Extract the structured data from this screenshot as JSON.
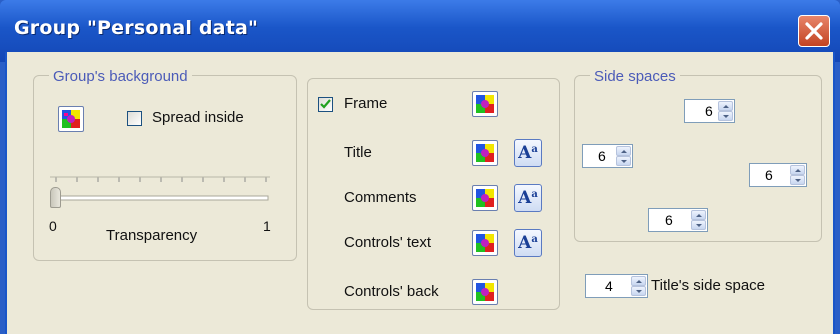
{
  "window": {
    "title": "Group \"Personal data\""
  },
  "background_group": {
    "legend": "Group's background",
    "spread_inside_label": "Spread inside",
    "spread_inside_checked": false,
    "transparency_label": "Transparency",
    "slider_min": "0",
    "slider_max": "1",
    "transparency_value": 0
  },
  "style_group": {
    "frame_label": "Frame",
    "frame_checked": true,
    "title_label": "Title",
    "comments_label": "Comments",
    "controls_text_label": "Controls' text",
    "controls_back_label": "Controls' back",
    "font_button_glyph": "A",
    "font_button_sup": "a"
  },
  "side_spaces": {
    "legend": "Side spaces",
    "top": "6",
    "left": "6",
    "right": "6",
    "bottom": "6"
  },
  "title_side_space": {
    "value": "4",
    "label": "Title's side space"
  },
  "icons": {
    "color_picker": "color-palette-icon",
    "font": "font-icon",
    "close": "close-icon",
    "check": "checkmark-icon"
  }
}
